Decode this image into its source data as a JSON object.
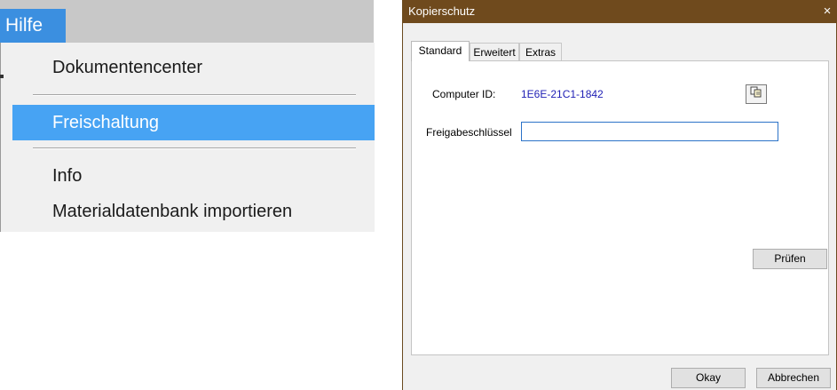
{
  "menu": {
    "top_label": "Hilfe",
    "items": [
      {
        "label": "Dokumentencenter"
      },
      {
        "label": "Freischaltung",
        "selected": true
      },
      {
        "label": "Info"
      },
      {
        "label": "Materialdatenbank importieren"
      }
    ]
  },
  "dialog": {
    "title": "Kopierschutz",
    "close_glyph": "×",
    "tabs": [
      {
        "label": "Standard",
        "active": true
      },
      {
        "label": "Erweitert"
      },
      {
        "label": "Extras"
      }
    ],
    "computer_id_label": "Computer ID:",
    "computer_id_value": "1E6E-21C1-1842",
    "copy_icon": "copy-icon",
    "key_label": "Freigabeschlüssel",
    "key_value": "",
    "check_button": "Prüfen",
    "ok_button": "Okay",
    "cancel_button": "Abbrechen"
  },
  "colors": {
    "menu_highlight": "#47a3f3",
    "titlebar": "#6f4a1d",
    "computer_id": "#1e1eb4"
  }
}
